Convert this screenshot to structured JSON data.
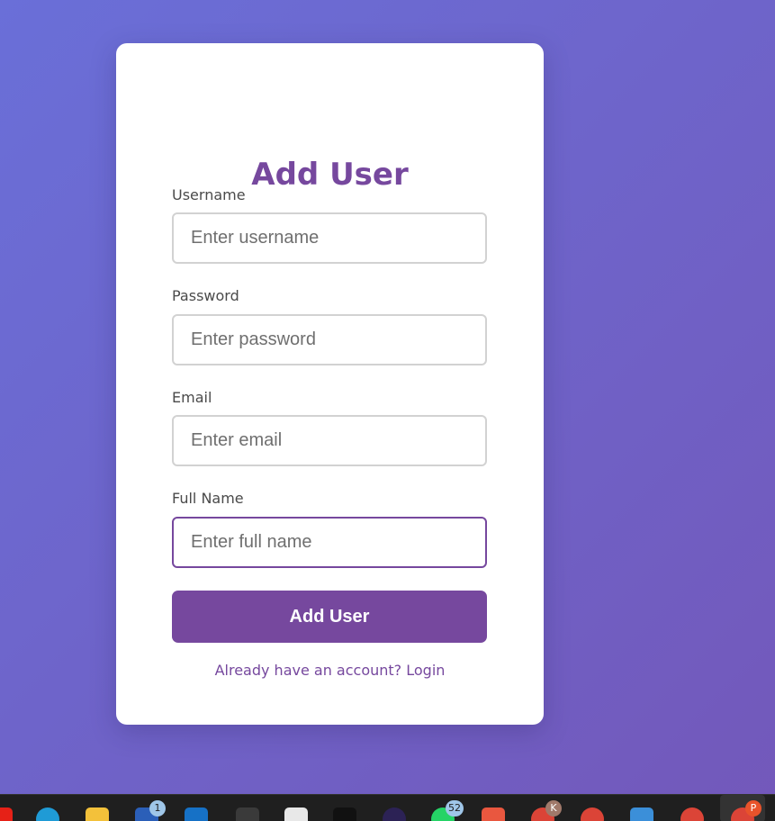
{
  "form": {
    "title": "Add User",
    "fields": [
      {
        "label": "Username",
        "placeholder": "Enter username",
        "value": ""
      },
      {
        "label": "Password",
        "placeholder": "Enter password",
        "value": ""
      },
      {
        "label": "Email",
        "placeholder": "Enter email",
        "value": ""
      },
      {
        "label": "Full Name",
        "placeholder": "Enter full name",
        "value": ""
      }
    ],
    "submit_label": "Add User",
    "login_link": "Already have an account? Login"
  },
  "taskbar": {
    "icons": [
      {
        "name": "youtube-icon",
        "color": "#e62117"
      },
      {
        "name": "edge-icon",
        "color": "#1f9bd6"
      },
      {
        "name": "file-explorer-icon",
        "color": "#f3c13a"
      },
      {
        "name": "word-icon",
        "color": "#2b5fb8",
        "badge": "1"
      },
      {
        "name": "outlook-icon",
        "color": "#1671c6"
      },
      {
        "name": "app-g-icon",
        "color": "#3a3a3a"
      },
      {
        "name": "store-icon",
        "color": "#e8e8e8"
      },
      {
        "name": "terminal-icon",
        "color": "#111111"
      },
      {
        "name": "eclipse-icon",
        "color": "#2c2255"
      },
      {
        "name": "whatsapp-icon",
        "color": "#25d366",
        "badge": "52"
      },
      {
        "name": "git-icon",
        "color": "#e9573f"
      },
      {
        "name": "chrome-k-icon",
        "color": "#db4437",
        "badge": "K"
      },
      {
        "name": "chrome-profile-icon",
        "color": "#db4437"
      },
      {
        "name": "remote-desktop-icon",
        "color": "#3b8fd9"
      },
      {
        "name": "chrome-profile-2-icon",
        "color": "#db4437"
      },
      {
        "name": "chrome-p-icon",
        "color": "#db4437",
        "badge": "P"
      }
    ]
  },
  "colors": {
    "accent": "#76489e",
    "background_start": "#6a6fd8",
    "background_end": "#7358ba"
  }
}
